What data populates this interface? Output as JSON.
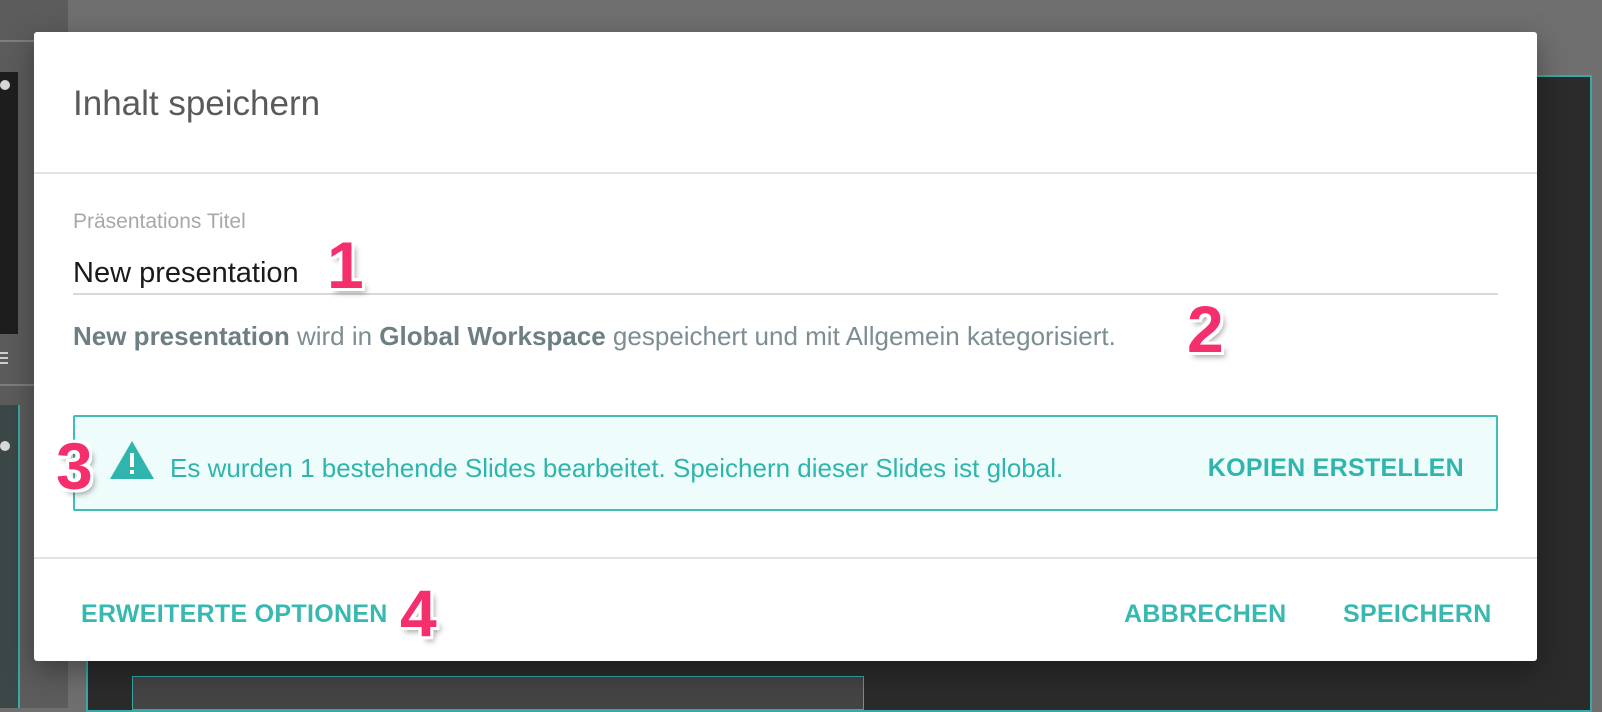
{
  "dialog": {
    "title": "Inhalt speichern",
    "title_field": {
      "label": "Präsentations Titel",
      "value": "New presentation"
    },
    "summary": {
      "name": "New presentation",
      "text_1": " wird in ",
      "workspace": "Global Workspace",
      "text_2": " gespeichert und mit Allgemein kategorisiert."
    },
    "alert": {
      "icon": "warning-icon",
      "message": "Es wurden 1 bestehende Slides bearbeitet. Speichern dieser Slides ist global.",
      "action_label": "KOPIEN ERSTELLEN",
      "color": "#2fb5ae"
    },
    "footer": {
      "advanced_label": "ERWEITERTE OPTIONEN",
      "cancel_label": "ABBRECHEN",
      "save_label": "SPEICHERN"
    }
  },
  "annotations": [
    "1",
    "2",
    "3",
    "4"
  ],
  "colors": {
    "accent": "#37b8b1",
    "annotation": "#f52f6c",
    "alert_background": "#eefcfb"
  }
}
